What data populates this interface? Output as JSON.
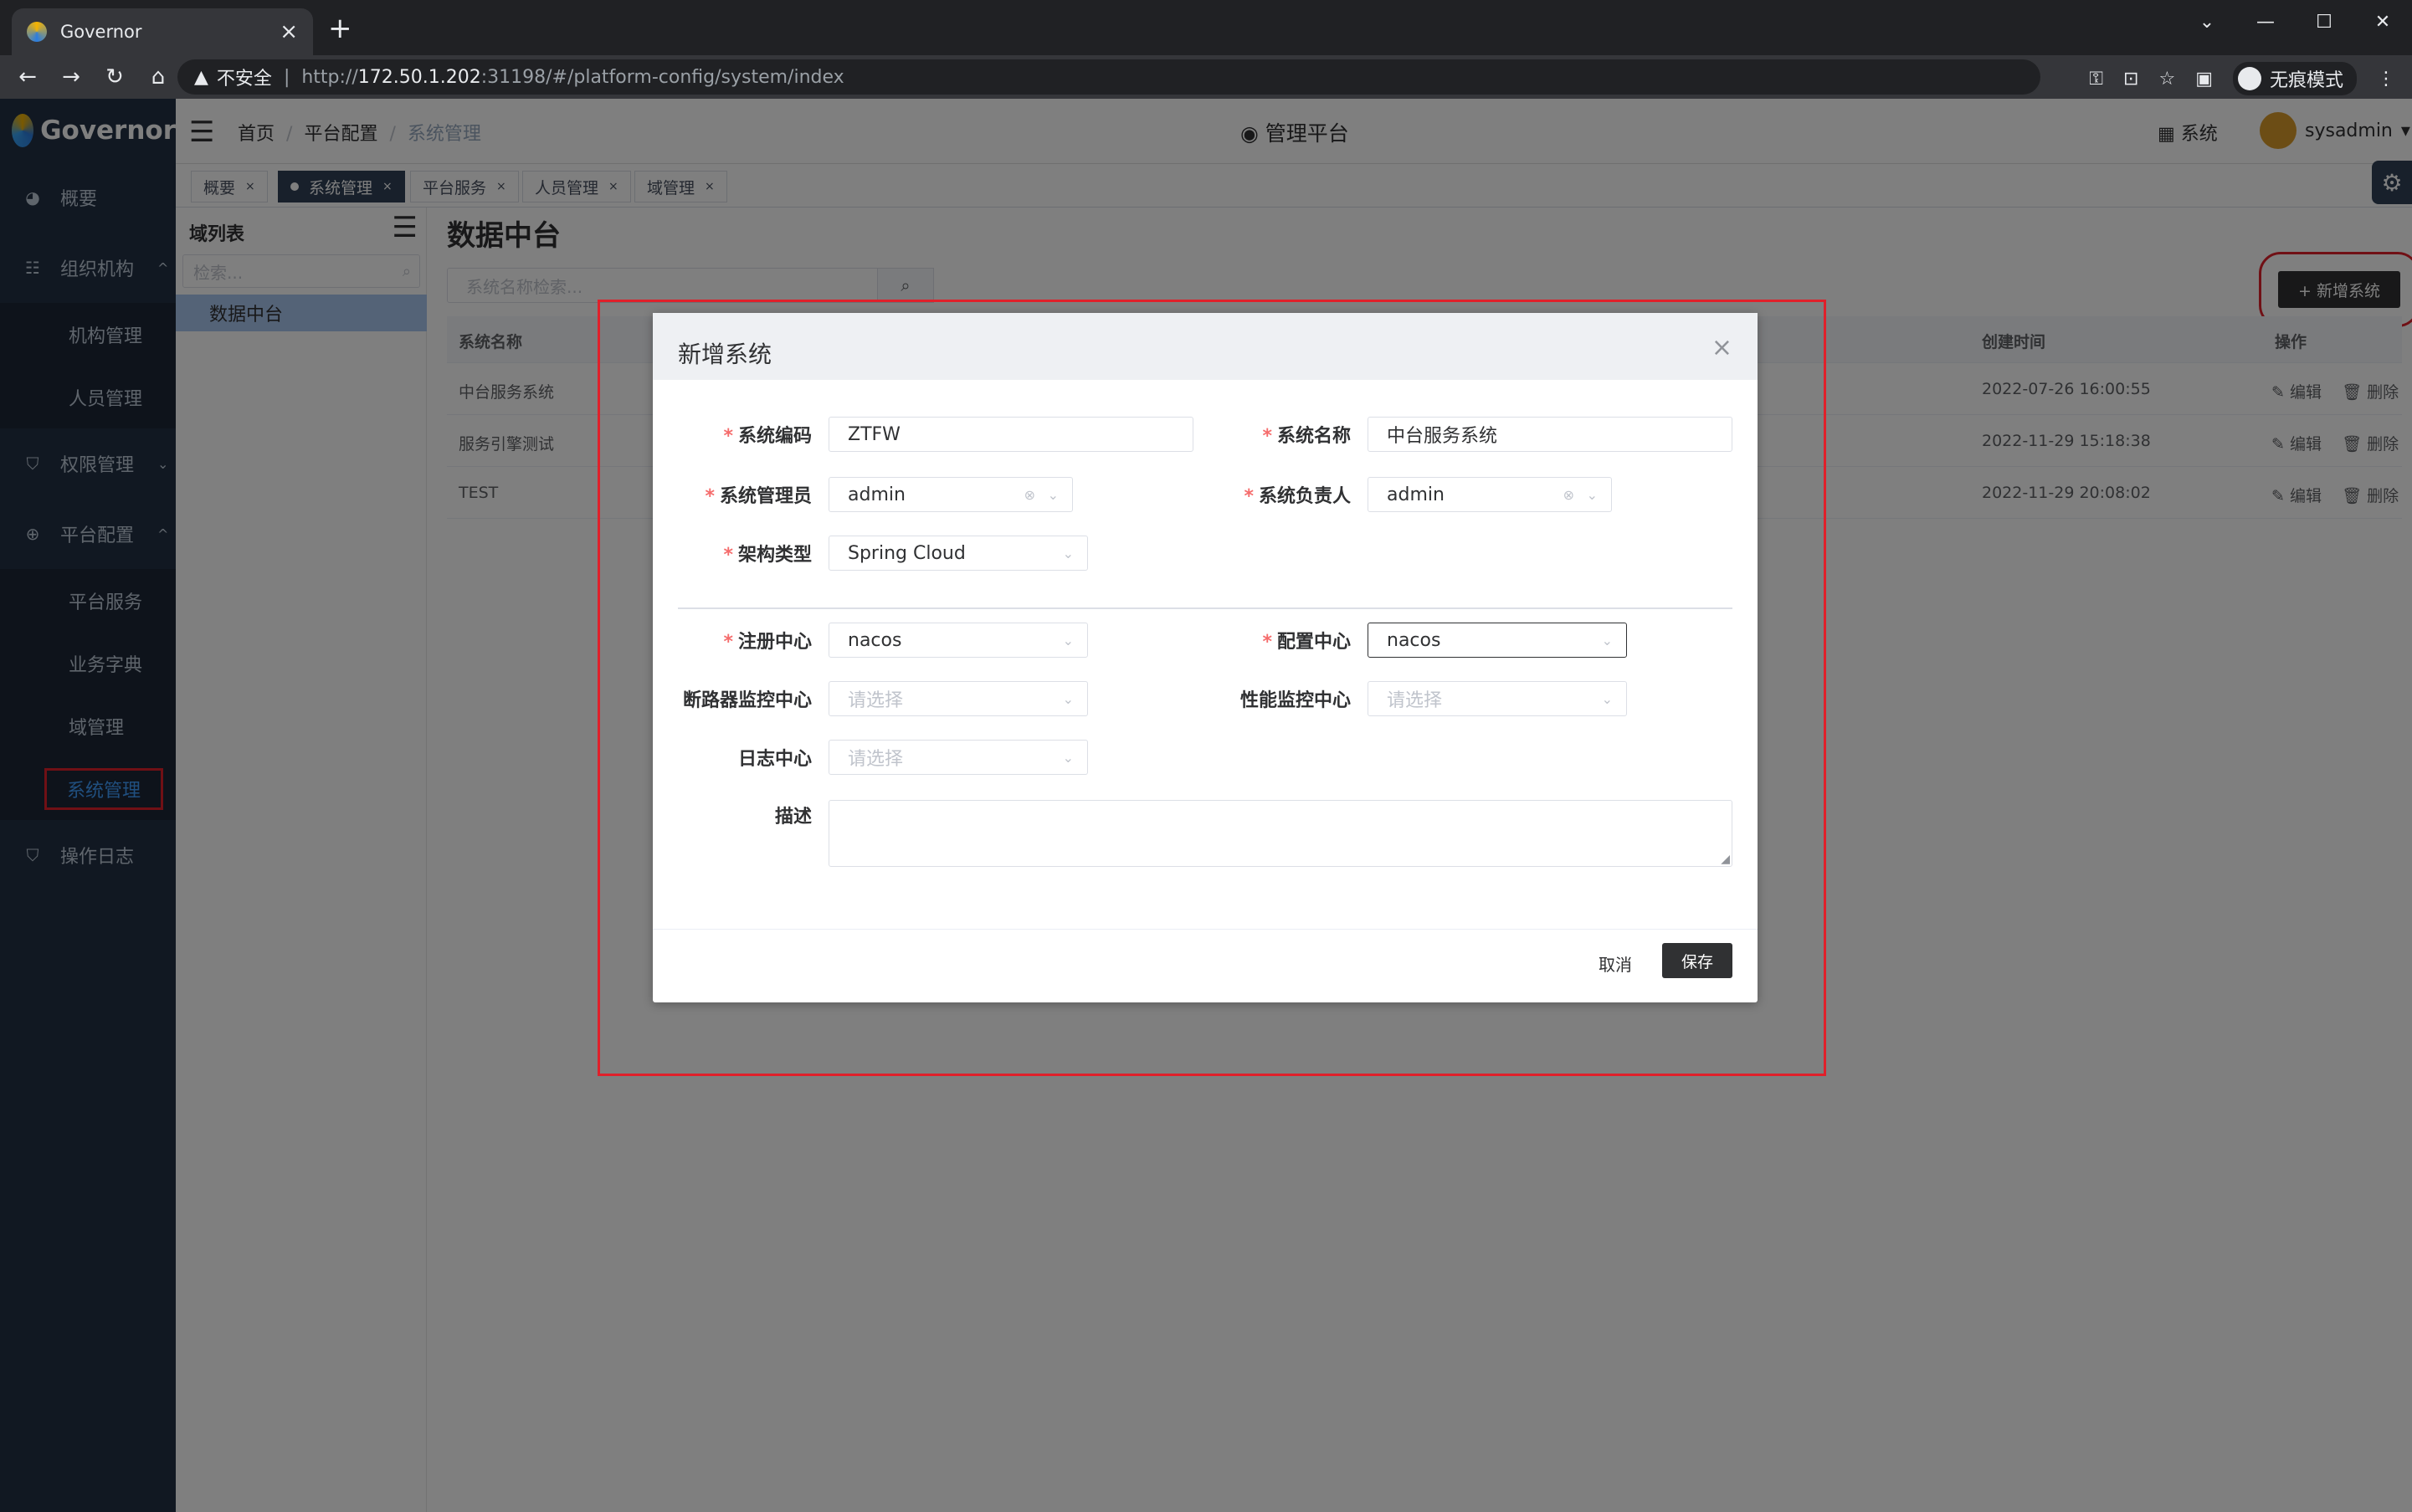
{
  "browser": {
    "tab_title": "Governor",
    "tab_close": "×",
    "new_tab": "+",
    "insecure": "不安全",
    "url_prefix": "http://",
    "url_host": "172.50.1.202",
    "url_rest": ":31198/#/platform-config/system/index",
    "incognito": "无痕模式"
  },
  "app": {
    "name": "Governor",
    "header_title": "管理平台",
    "system_label": "系统",
    "username": "sysadmin"
  },
  "breadcrumb": [
    "首页",
    "平台配置",
    "系统管理"
  ],
  "sidebar": {
    "items": [
      {
        "label": "概要",
        "icon": "dashboard-icon"
      },
      {
        "label": "组织机构",
        "icon": "org-icon",
        "expanded": true,
        "children": [
          "机构管理",
          "人员管理"
        ]
      },
      {
        "label": "权限管理",
        "icon": "shield-icon",
        "expanded": false
      },
      {
        "label": "平台配置",
        "icon": "globe-icon",
        "expanded": true,
        "children": [
          "平台服务",
          "业务字典",
          "域管理",
          "系统管理"
        ]
      },
      {
        "label": "操作日志",
        "icon": "log-icon"
      }
    ]
  },
  "tags": [
    "概要",
    "系统管理",
    "平台服务",
    "人员管理",
    "域管理"
  ],
  "domain_panel": {
    "title": "域列表",
    "search_placeholder": "检索...",
    "items": [
      "数据中台"
    ]
  },
  "main": {
    "title": "数据中台",
    "search_placeholder": "系统名称检索...",
    "add_button": "+ 新增系统",
    "columns": {
      "name": "系统名称",
      "created": "创建时间",
      "actions": "操作"
    },
    "rows": [
      {
        "name": "中台服务系统",
        "created": "2022-07-26 16:00:55"
      },
      {
        "name": "服务引擎测试",
        "created": "2022-11-29 15:18:38"
      },
      {
        "name": "TEST",
        "created": "2022-11-29 20:08:02"
      }
    ],
    "edit": "编辑",
    "delete": "删除"
  },
  "dialog": {
    "title": "新增系统",
    "fields": {
      "code_label": "系统编码",
      "code_value": "ZTFW",
      "name_label": "系统名称",
      "name_value": "中台服务系统",
      "admin_label": "系统管理员",
      "admin_value": "admin",
      "owner_label": "系统负责人",
      "owner_value": "admin",
      "arch_label": "架构类型",
      "arch_value": "Spring Cloud",
      "registry_label": "注册中心",
      "registry_value": "nacos",
      "config_label": "配置中心",
      "config_value": "nacos",
      "breaker_label": "断路器监控中心",
      "breaker_placeholder": "请选择",
      "perf_label": "性能监控中心",
      "perf_placeholder": "请选择",
      "log_label": "日志中心",
      "log_placeholder": "请选择",
      "desc_label": "描述"
    },
    "cancel": "取消",
    "save": "保存"
  }
}
